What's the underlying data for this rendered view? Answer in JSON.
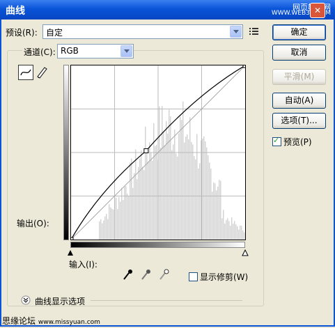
{
  "window": {
    "title": "曲线",
    "close_icon": "close-icon"
  },
  "watermark": {
    "line1": "网页教学网",
    "line2": "WWW.WEB3X.COM"
  },
  "preset": {
    "label": "预设(R):",
    "value": "自定"
  },
  "channel": {
    "label": "通道(C):",
    "value": "RGB"
  },
  "buttons": {
    "ok": "确定",
    "cancel": "取消",
    "smooth": "平滑(M)",
    "auto": "自动(A)",
    "options": "选项(T)..."
  },
  "preview": {
    "label": "预览(P)",
    "checked": true
  },
  "output_label": "输出(O):",
  "input_label": "输入(I):",
  "show_clipping": {
    "label": "显示修剪(W)",
    "checked": false
  },
  "curve_options_label": "曲线显示选项",
  "footer": {
    "forum": "思缘论坛",
    "url": "www.missyuan.com"
  },
  "curve": {
    "points": [
      [
        0,
        0
      ],
      [
        110,
        130
      ],
      [
        255,
        255
      ]
    ]
  },
  "colors": {
    "titlebar": "#0a54d8",
    "dialog_bg": "#ece9d8",
    "histogram": "#d4d4d4"
  }
}
